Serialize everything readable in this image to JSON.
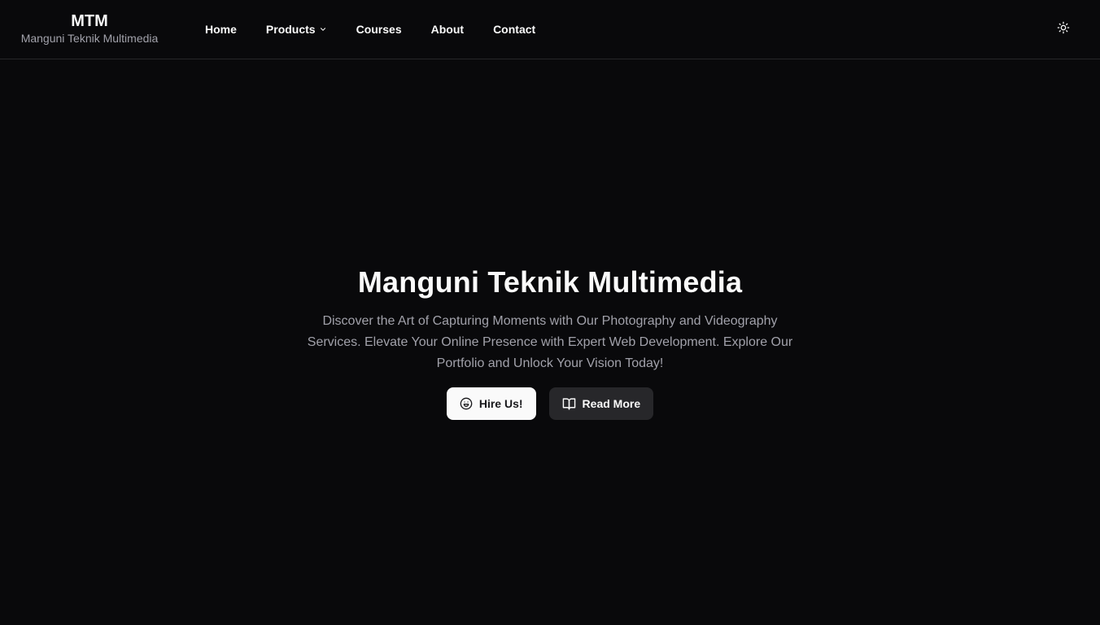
{
  "brand": {
    "title": "MTM",
    "subtitle": "Manguni Teknik Multimedia"
  },
  "nav": {
    "items": [
      {
        "label": "Home"
      },
      {
        "label": "Products",
        "icon": "chevron-down-icon"
      },
      {
        "label": "Courses"
      },
      {
        "label": "About"
      },
      {
        "label": "Contact"
      }
    ],
    "theme_toggle_icon": "sun-icon"
  },
  "hero": {
    "title": "Manguni Teknik Multimedia",
    "description": "Discover the Art of Capturing Moments with Our Photography and Videography Services. Elevate Your Online Presence with Expert Web Development. Explore Our Portfolio and Unlock Your Vision Today!",
    "primary_button": {
      "label": "Hire Us!",
      "icon": "smile-icon"
    },
    "secondary_button": {
      "label": "Read More",
      "icon": "book-open-icon"
    }
  },
  "colors": {
    "background": "#09090b",
    "text": "#fafafa",
    "muted_text": "#a1a1aa",
    "border": "#27272a",
    "primary_button_bg": "#fafafa",
    "secondary_button_bg": "#27272a"
  }
}
